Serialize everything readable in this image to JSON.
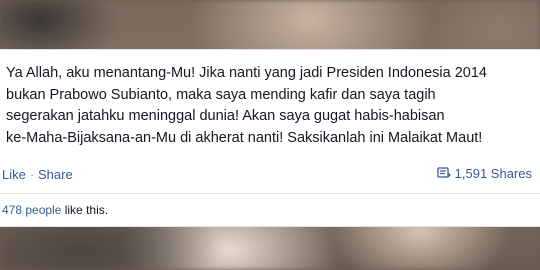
{
  "post": {
    "text": "Ya Allah, aku menantang-Mu! Jika nanti yang jadi Presiden Indonesia 2014\nbukan Prabowo Subianto, maka saya mending kafir dan saya tagih\nsegerakan jatahku meninggal dunia! Akan saya gugat habis-habisan\nke-Maha-Bijaksana-an-Mu di akherat nanti! Saksikanlah ini Malaikat Maut!"
  },
  "actions": {
    "like_label": "Like",
    "separator": "·",
    "share_label": "Share",
    "shares_count": "1,591 Shares",
    "shares_icon": "share-count-icon"
  },
  "likes": {
    "people_label": "478 people",
    "suffix": " like this."
  },
  "colors": {
    "link": "#3b5998",
    "text": "#141823"
  }
}
